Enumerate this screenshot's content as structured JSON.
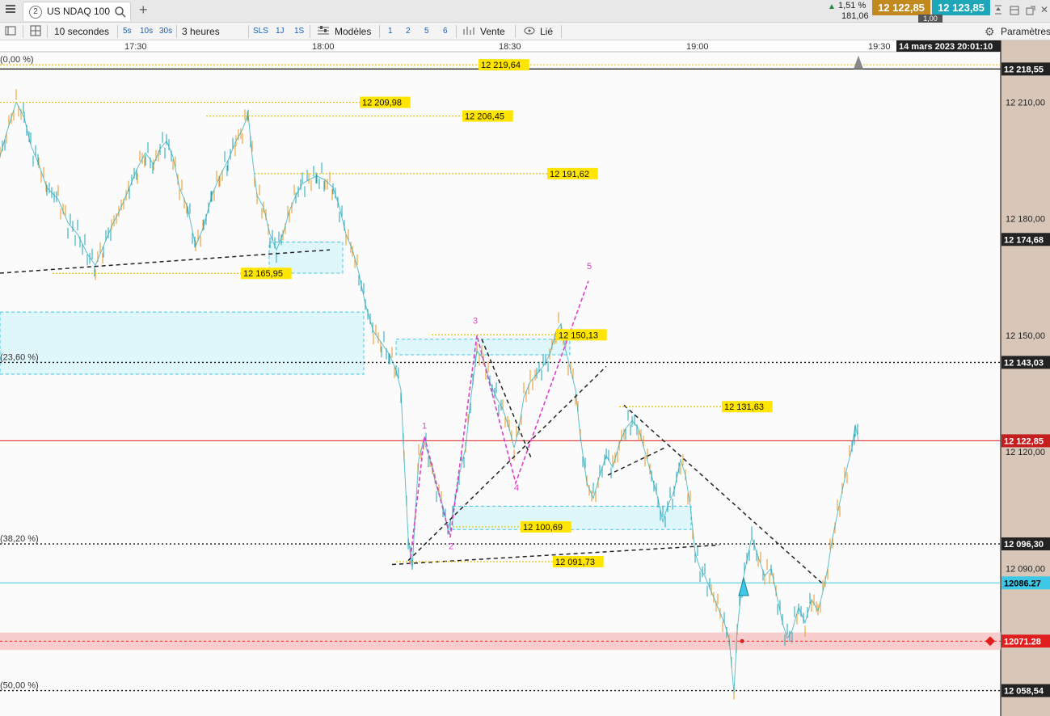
{
  "tab": {
    "badge": "2",
    "title": "US NDAQ 100",
    "new_tab": "+"
  },
  "quote": {
    "change_pct": "1,51 %",
    "change_abs": "181,06",
    "bid": "12 122,85",
    "ask": "12 123,85",
    "spread": "1,00",
    "up_color": "#1e8a3c",
    "bid_color": "#c28a1e",
    "ask_color": "#1ea7b8"
  },
  "toolbar": {
    "interval": "10 secondes",
    "intervals": [
      "5s",
      "10s",
      "30s"
    ],
    "period": "3 heures",
    "periods": [
      "SLS",
      "1J",
      "1S"
    ],
    "models": "Modèles",
    "numbers": [
      "1",
      "2",
      "5",
      "6"
    ],
    "sell": "Vente",
    "linked": "Lié",
    "settings": "Paramètres"
  },
  "chart_data": {
    "type": "line",
    "instrument": "US NDAQ 100",
    "time_labels": [
      "17:30",
      "18:00",
      "18:30",
      "19:00",
      "19:30"
    ],
    "timestamp": "14 mars 2023 20:01:10",
    "ylim": [
      12052,
      12223
    ],
    "y_ticks": [
      {
        "v": 12210,
        "label": "12 210,00"
      },
      {
        "v": 12180,
        "label": "12 180,00"
      },
      {
        "v": 12150,
        "label": "12 150,00"
      },
      {
        "v": 12120,
        "label": "12 120,00"
      },
      {
        "v": 12090,
        "label": "12 090,00"
      }
    ],
    "badges": [
      {
        "v": 12218.55,
        "label": "12 218,55",
        "bg": "#222222",
        "fg": "#ffffff"
      },
      {
        "v": 12174.68,
        "label": "12 174,68",
        "bg": "#222222",
        "fg": "#ffffff"
      },
      {
        "v": 12143.03,
        "label": "12 143,03",
        "bg": "#222222",
        "fg": "#ffffff"
      },
      {
        "v": 12122.85,
        "label": "12 122,85",
        "bg": "#c41e1e",
        "fg": "#ffffff"
      },
      {
        "v": 12096.3,
        "label": "12 096,30",
        "bg": "#222222",
        "fg": "#ffffff"
      },
      {
        "v": 12086.27,
        "label": "12086.27",
        "bg": "#3cc8e6",
        "fg": "#000000"
      },
      {
        "v": 12071.28,
        "label": "12071.28",
        "bg": "#e01e1e",
        "fg": "#ffffff"
      },
      {
        "v": 12058.54,
        "label": "12 058,54",
        "bg": "#222222",
        "fg": "#ffffff"
      }
    ],
    "fib_levels": [
      {
        "v": 12219.64,
        "label": "(0,00 %)"
      },
      {
        "v": 12143.03,
        "label": "(23,60 %)"
      },
      {
        "v": 12096.3,
        "label": "(38,20 %)"
      },
      {
        "v": 12058.54,
        "label": "(50,00 %)"
      }
    ],
    "level_labels": [
      {
        "v": 12219.64,
        "label": "12 219,64"
      },
      {
        "v": 12209.98,
        "label": "12 209,98"
      },
      {
        "v": 12206.45,
        "label": "12 206,45"
      },
      {
        "v": 12191.62,
        "label": "12 191,62"
      },
      {
        "v": 12165.95,
        "label": "12 165,95"
      },
      {
        "v": 12150.13,
        "label": "12 150,13"
      },
      {
        "v": 12131.63,
        "label": "12 131,63"
      },
      {
        "v": 12100.69,
        "label": "12 100,69"
      },
      {
        "v": 12091.73,
        "label": "12 091,73"
      }
    ],
    "wave_labels": [
      "1",
      "2",
      "3",
      "4",
      "5"
    ],
    "price_path": [
      [
        0,
        12196
      ],
      [
        8,
        12202
      ],
      [
        20,
        12210
      ],
      [
        30,
        12206
      ],
      [
        38,
        12199
      ],
      [
        48,
        12194
      ],
      [
        58,
        12188
      ],
      [
        72,
        12185
      ],
      [
        84,
        12179
      ],
      [
        96,
        12176
      ],
      [
        108,
        12171
      ],
      [
        118,
        12168
      ],
      [
        128,
        12173
      ],
      [
        138,
        12178
      ],
      [
        150,
        12183
      ],
      [
        160,
        12188
      ],
      [
        170,
        12193
      ],
      [
        180,
        12197
      ],
      [
        190,
        12194
      ],
      [
        198,
        12198
      ],
      [
        206,
        12200
      ],
      [
        214,
        12196
      ],
      [
        222,
        12188
      ],
      [
        232,
        12183
      ],
      [
        242,
        12173
      ],
      [
        252,
        12178
      ],
      [
        262,
        12186
      ],
      [
        272,
        12191
      ],
      [
        282,
        12195
      ],
      [
        292,
        12200
      ],
      [
        300,
        12203
      ],
      [
        307,
        12207
      ],
      [
        312,
        12196
      ],
      [
        318,
        12186
      ],
      [
        326,
        12183
      ],
      [
        334,
        12176
      ],
      [
        342,
        12172
      ],
      [
        350,
        12176
      ],
      [
        358,
        12182
      ],
      [
        366,
        12186
      ],
      [
        374,
        12189
      ],
      [
        382,
        12190
      ],
      [
        392,
        12191
      ],
      [
        402,
        12190
      ],
      [
        412,
        12188
      ],
      [
        420,
        12183
      ],
      [
        428,
        12176
      ],
      [
        436,
        12172
      ],
      [
        444,
        12166
      ],
      [
        452,
        12158
      ],
      [
        462,
        12151
      ],
      [
        472,
        12148
      ],
      [
        482,
        12145
      ],
      [
        490,
        12141
      ],
      [
        496,
        12136
      ],
      [
        500,
        12118
      ],
      [
        505,
        12098
      ],
      [
        510,
        12090
      ],
      [
        514,
        12105
      ],
      [
        518,
        12118
      ],
      [
        524,
        12123
      ],
      [
        532,
        12118
      ],
      [
        540,
        12111
      ],
      [
        548,
        12106
      ],
      [
        554,
        12100
      ],
      [
        560,
        12104
      ],
      [
        568,
        12114
      ],
      [
        576,
        12121
      ],
      [
        582,
        12133
      ],
      [
        590,
        12146
      ],
      [
        598,
        12144
      ],
      [
        606,
        12138
      ],
      [
        614,
        12134
      ],
      [
        622,
        12131
      ],
      [
        630,
        12126
      ],
      [
        636,
        12121
      ],
      [
        642,
        12126
      ],
      [
        648,
        12134
      ],
      [
        656,
        12138
      ],
      [
        664,
        12140
      ],
      [
        672,
        12142
      ],
      [
        680,
        12145
      ],
      [
        688,
        12151
      ],
      [
        694,
        12153
      ],
      [
        700,
        12146
      ],
      [
        706,
        12141
      ],
      [
        712,
        12136
      ],
      [
        718,
        12124
      ],
      [
        726,
        12112
      ],
      [
        734,
        12108
      ],
      [
        742,
        12114
      ],
      [
        750,
        12119
      ],
      [
        758,
        12116
      ],
      [
        766,
        12122
      ],
      [
        774,
        12126
      ],
      [
        782,
        12128
      ],
      [
        790,
        12126
      ],
      [
        798,
        12120
      ],
      [
        806,
        12114
      ],
      [
        814,
        12108
      ],
      [
        820,
        12102
      ],
      [
        826,
        12106
      ],
      [
        834,
        12110
      ],
      [
        842,
        12118
      ],
      [
        848,
        12114
      ],
      [
        854,
        12106
      ],
      [
        860,
        12094
      ],
      [
        866,
        12090
      ],
      [
        872,
        12088
      ],
      [
        880,
        12084
      ],
      [
        888,
        12080
      ],
      [
        896,
        12076
      ],
      [
        902,
        12072
      ],
      [
        908,
        12058
      ],
      [
        912,
        12074
      ],
      [
        918,
        12086
      ],
      [
        924,
        12092
      ],
      [
        930,
        12098
      ],
      [
        938,
        12093
      ],
      [
        946,
        12088
      ],
      [
        954,
        12090
      ],
      [
        962,
        12082
      ],
      [
        968,
        12076
      ],
      [
        974,
        12072
      ],
      [
        980,
        12074
      ],
      [
        988,
        12080
      ],
      [
        996,
        12076
      ],
      [
        1004,
        12082
      ],
      [
        1012,
        12079
      ],
      [
        1018,
        12084
      ],
      [
        1024,
        12090
      ],
      [
        1030,
        12098
      ],
      [
        1036,
        12104
      ],
      [
        1042,
        12110
      ],
      [
        1048,
        12116
      ],
      [
        1054,
        12121
      ],
      [
        1058,
        12127
      ],
      [
        1062,
        12123
      ]
    ]
  }
}
